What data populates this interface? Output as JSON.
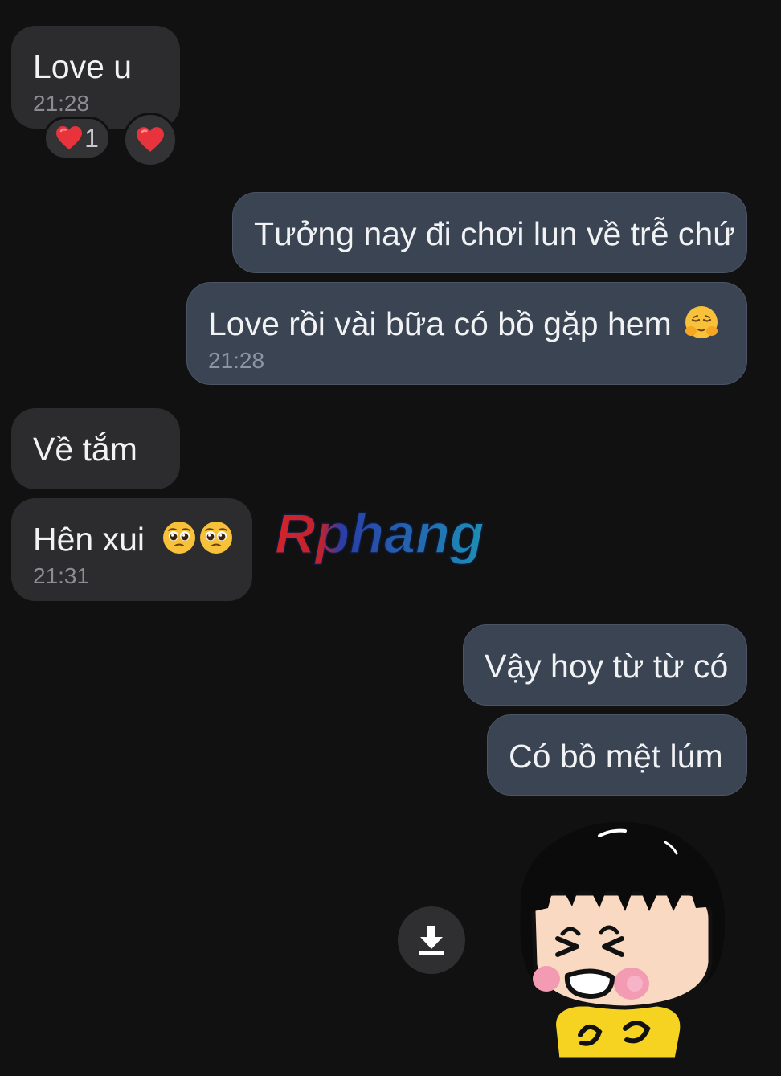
{
  "messages": [
    {
      "id": "m1",
      "direction": "incoming",
      "text": "Love u",
      "time": "21:28"
    },
    {
      "id": "m2",
      "direction": "outgoing",
      "text": "Tưởng nay đi chơi lun về trễ chứ"
    },
    {
      "id": "m3",
      "direction": "outgoing",
      "text": "Love rồi vài bữa có bồ gặp hem",
      "emoji": "hugging-face-emoji",
      "time": "21:28"
    },
    {
      "id": "m4",
      "direction": "incoming",
      "text": "Về tắm"
    },
    {
      "id": "m5",
      "direction": "incoming",
      "text": "Hên xui",
      "emoji": "pleading-face-emoji x2",
      "time": "21:31"
    },
    {
      "id": "m6",
      "direction": "outgoing",
      "text": "Vậy hoy từ từ có"
    },
    {
      "id": "m7",
      "direction": "outgoing",
      "text": "Có bồ mệt lúm"
    }
  ],
  "reactions": {
    "heart_count": "1",
    "heart_icon": "red-heart-icon",
    "add_reaction_icon": "red-heart-icon"
  },
  "watermark": {
    "text": "Rphang"
  },
  "sticker": {
    "icon": "cartoon-girl-laughing-sticker"
  },
  "download": {
    "icon": "download-arrow-icon"
  },
  "colors": {
    "background": "#111112",
    "incoming_bubble": "#2c2c2e",
    "outgoing_bubble": "#3b4452",
    "text": "#f1f2f4",
    "timestamp": "#8c8d92"
  }
}
